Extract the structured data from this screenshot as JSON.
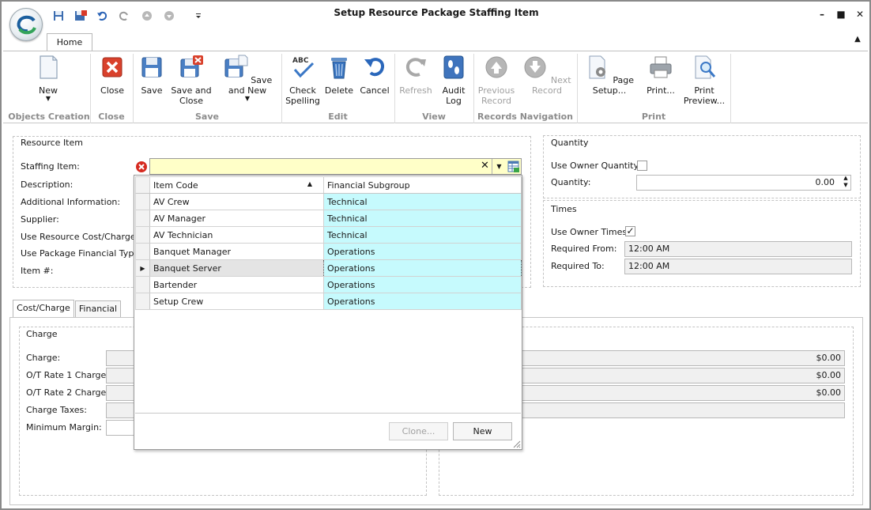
{
  "window": {
    "title": "Setup Resource Package Staffing Item",
    "controls": [
      "–",
      "■",
      "✕"
    ]
  },
  "ribbon": {
    "tab": "Home",
    "groups": {
      "objects_creation": "Objects Creation",
      "close": "Close",
      "save": "Save",
      "edit": "Edit",
      "view": "View",
      "records_navigation": "Records Navigation",
      "print": "Print"
    },
    "buttons": {
      "new": "New",
      "close": "Close",
      "save": "Save",
      "save_and_close_1": "Save and",
      "save_and_close_2": "Close",
      "save_and_new": "Save and New",
      "check_spelling_1": "Check",
      "check_spelling_2": "Spelling",
      "delete": "Delete",
      "cancel": "Cancel",
      "refresh": "Refresh",
      "audit_log_1": "Audit",
      "audit_log_2": "Log",
      "previous_record_1": "Previous",
      "previous_record_2": "Record",
      "next_record": "Next Record",
      "page_setup": "Page Setup...",
      "print": "Print...",
      "print_preview_1": "Print",
      "print_preview_2": "Preview..."
    }
  },
  "resource_item": {
    "legend": "Resource Item",
    "labels": {
      "staffing_item": "Staffing Item:",
      "description": "Description:",
      "additional_information": "Additional Information:",
      "supplier": "Supplier:",
      "use_resource_cost": "Use Resource Cost/Charge:",
      "use_package_financial": "Use Package Financial Type:",
      "item_number": "Item #:"
    }
  },
  "dropdown": {
    "headers": {
      "item_code": "Item Code",
      "financial_subgroup": "Financial Subgroup"
    },
    "rows": [
      {
        "code": "AV Crew",
        "subgroup": "Technical"
      },
      {
        "code": "AV Manager",
        "subgroup": "Technical"
      },
      {
        "code": "AV Technician",
        "subgroup": "Technical"
      },
      {
        "code": "Banquet Manager",
        "subgroup": "Operations"
      },
      {
        "code": "Banquet Server",
        "subgroup": "Operations"
      },
      {
        "code": "Bartender",
        "subgroup": "Operations"
      },
      {
        "code": "Setup Crew",
        "subgroup": "Operations"
      }
    ],
    "clone_button": "Clone...",
    "new_button": "New"
  },
  "quantity": {
    "legend": "Quantity",
    "use_owner_quantity": "Use Owner Quantity:",
    "quantity_label": "Quantity:",
    "quantity_value": "0.00"
  },
  "times": {
    "legend": "Times",
    "use_owner_times": "Use Owner Times:",
    "check_mark": "✓",
    "required_from": "Required From:",
    "required_from_value": "12:00 AM",
    "required_to": "Required To:",
    "required_to_value": "12:00 AM"
  },
  "tabs": {
    "cost_charge": "Cost/Charge",
    "financial": "Financial"
  },
  "charge": {
    "legend": "Charge",
    "labels": {
      "charge": "Charge:",
      "ot1": "O/T Rate 1 Charge:",
      "ot2": "O/T Rate 2 Charge:",
      "taxes": "Charge Taxes:",
      "margin": "Minimum Margin:"
    },
    "values": {
      "charge": "$0.00",
      "ot1": "$0.00",
      "ot2": "$0.00"
    }
  }
}
